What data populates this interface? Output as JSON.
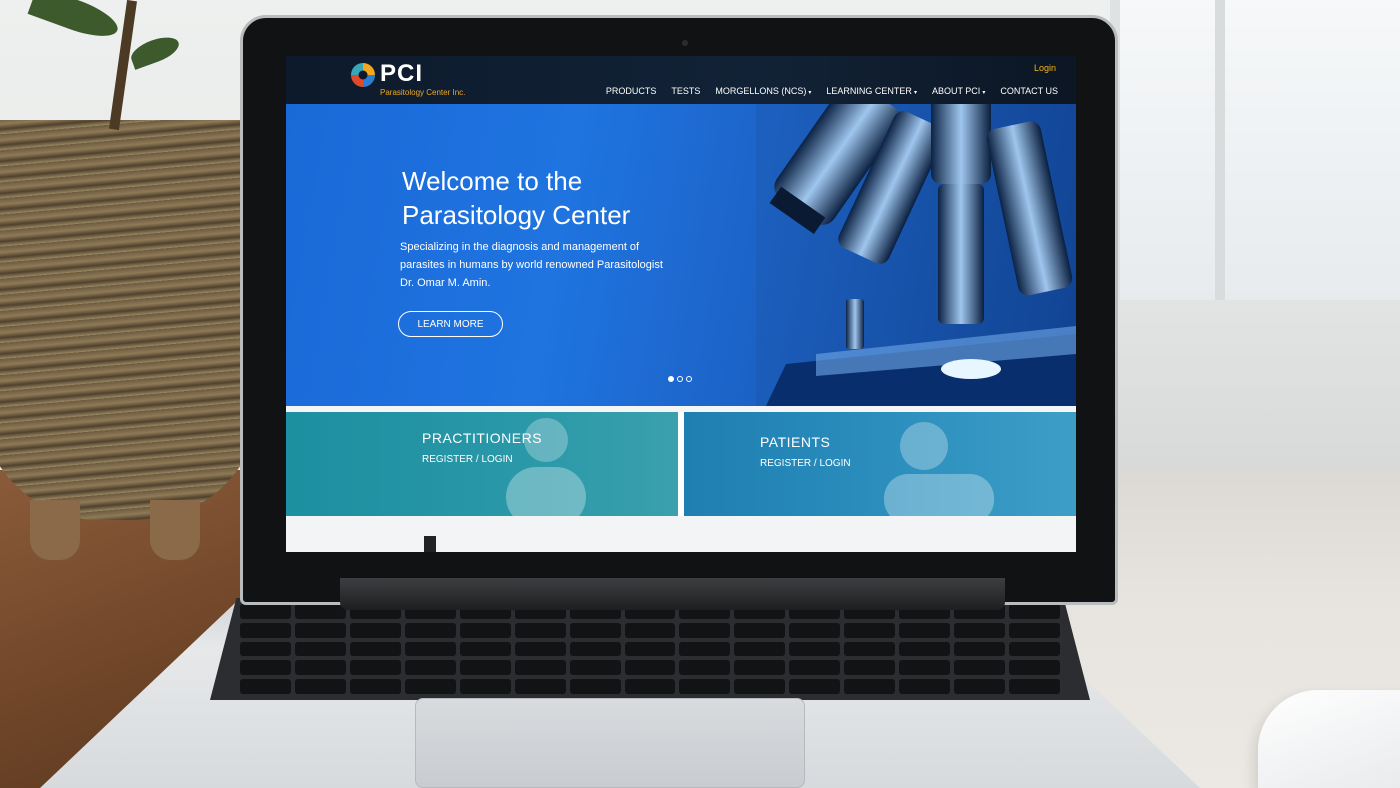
{
  "site": {
    "brand": "PCI",
    "brand_sub": "Parasitology Center Inc.",
    "login": "Login",
    "nav": [
      {
        "label": "PRODUCTS",
        "dropdown": false
      },
      {
        "label": "TESTS",
        "dropdown": false
      },
      {
        "label": "MORGELLONS (NCS)",
        "dropdown": true
      },
      {
        "label": "LEARNING CENTER",
        "dropdown": true
      },
      {
        "label": "ABOUT PCI",
        "dropdown": true
      },
      {
        "label": "CONTACT US",
        "dropdown": false
      }
    ],
    "nav_caret": "▾"
  },
  "hero": {
    "title_line1": "Welcome to the",
    "title_line2": "Parasitology Center",
    "text": "Specializing in the diagnosis and management of parasites in humans by world renowned Parasitologist Dr. Omar M. Amin.",
    "button": "LEARN MORE",
    "slides": 3,
    "active_slide": 1
  },
  "tiles": {
    "practitioners": {
      "title": "PRACTITIONERS",
      "link": "REGISTER / LOGIN"
    },
    "patients": {
      "title": "PATIENTS",
      "link": "REGISTER / LOGIN"
    }
  },
  "colors": {
    "header": "#0d1a2c",
    "accent": "#f2a71d",
    "hero": "#1a69d8",
    "practitioners_tile": "#1c8fa0",
    "patients_tile": "#1e7fb0"
  }
}
